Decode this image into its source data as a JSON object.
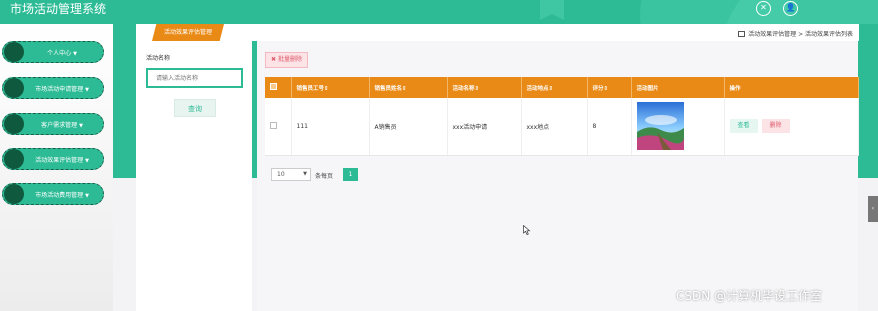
{
  "header": {
    "title": "市场活动管理系统",
    "icons": [
      "close-circle-icon",
      "user-icon"
    ]
  },
  "sidebar": {
    "items": [
      {
        "label": "个人中心"
      },
      {
        "label": "市场活动申请管理"
      },
      {
        "label": "客户需求管理"
      },
      {
        "label": "活动效果评估管理"
      },
      {
        "label": "市场活动费用管理"
      }
    ]
  },
  "breadcrumb": {
    "tab_label": "活动效果评估管理",
    "path": "活动效果评估管理 > 活动效果评估列表"
  },
  "search": {
    "label": "活动名称",
    "placeholder": "请输入活动名称",
    "button": "查询"
  },
  "toolbar": {
    "batch_delete": "批量删除"
  },
  "table": {
    "headers": [
      "销售员工号",
      "销售员姓名",
      "活动名称",
      "活动地点",
      "评分",
      "活动图片",
      "操作"
    ],
    "rows": [
      {
        "employee_no": "111",
        "employee_name": "A销售员",
        "activity_name": "xxx活动申请",
        "location": "xxx地点",
        "score": "8",
        "view": "查看",
        "delete": "删除"
      }
    ]
  },
  "pagination": {
    "page_size": "10",
    "per_page_label": "条每页",
    "current_page": "1"
  },
  "watermark": "CSDN @计算机毕设工作室",
  "colors": {
    "primary": "#2dbb96",
    "accent": "#e98a16",
    "danger": "#e05a6c"
  }
}
